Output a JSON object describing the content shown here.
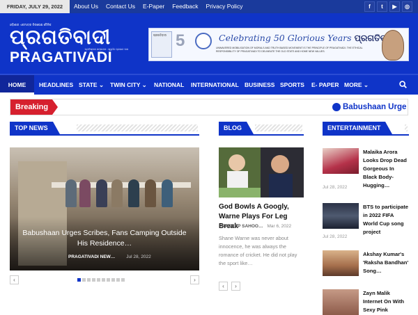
{
  "topbar": {
    "date": "FRIDAY, JULY 29, 2022",
    "links": [
      "About Us",
      "Contact Us",
      "E-Paper",
      "Feedback",
      "Privacy Policy"
    ],
    "social_icons": [
      "facebook-icon",
      "twitter-icon",
      "youtube-icon",
      "instagram-icon"
    ],
    "social_glyphs": [
      "f",
      "t",
      "▶",
      "◎"
    ]
  },
  "logo": {
    "tagline": "ଓଡ଼ିଶାର ଏକମାତ୍ର ନିରପେକ୍ଷ ଦୈନିକ",
    "odia_name": "ପ୍ରଗତିବାଦୀ",
    "founder": "ପ୍ରତିଷ୍ଠାତା ସମ୍ପାଦକ : ସ୍ୱର୍ଗତ ପ୍ରଭାତ ଦାସ",
    "english_name": "PRAGATIVADI"
  },
  "banner": {
    "mini_text": "ପ୍ରଗତିବାଦୀ",
    "fifty": "5",
    "celebrating": "Celebrating 50 Glorious Years",
    "brand": "ପ୍ରଗତିବାଦୀ",
    "small_text": "UNWAVERED MOBILISATION OF MORALS AND TRUTH BASED MOVEMENT IS THE PRINCIPLE OF PRAGATIVADI. THE ETHICAL RESPONSIBILITY OF PRAGATIVADI TO DELINEATE THE OLD STATE AND HOME NEW VALUES."
  },
  "nav": {
    "items": [
      {
        "label": "HOME",
        "caret": ""
      },
      {
        "label": "HEADLINES",
        "caret": ""
      },
      {
        "label": "STATE",
        "caret": "⌄"
      },
      {
        "label": "TWIN CITY",
        "caret": "⌄"
      },
      {
        "label": "NATIONAL",
        "caret": ""
      },
      {
        "label": "INTERNATIONAL",
        "caret": ""
      },
      {
        "label": "BUSINESS",
        "caret": ""
      },
      {
        "label": "SPORTS",
        "caret": ""
      },
      {
        "label": "E- PAPER",
        "caret": ""
      },
      {
        "label": "MORE",
        "caret": "⌄"
      }
    ]
  },
  "breaking": {
    "label": "Breaking",
    "headline": "Babushaan Urge"
  },
  "sections": {
    "top_news": "TOP NEWS",
    "blog": "BLOG",
    "entertainment": "ENTERTAINMENT"
  },
  "top_news": {
    "caption": "Babushaan Urges Scribes, Fans Camping Outside His Residence…",
    "author": "PRAGATIVADI NEW…",
    "date": "Jul 28, 2022",
    "prev": "‹",
    "next": "›",
    "dots_total": 10,
    "dots_active": 0
  },
  "blog": {
    "title": "God Bowls A Googly, Warne Plays For Leg Break",
    "author": "PRADEEP SAHOO…",
    "date": "Mar 6, 2022",
    "excerpt": "Shane Warne was never about innocence, he was always the romance of cricket. He did not play the sport like…",
    "prev": "‹",
    "next": "›"
  },
  "entertainment": [
    {
      "title": "Malaika Arora Looks Drop Dead Gorgeous In Black Body-Hugging…",
      "date": "Jul 28, 2022"
    },
    {
      "title": "BTS to participate in 2022 FIFA World Cup song project",
      "date": "Jul 28, 2022"
    },
    {
      "title": "Akshay Kumar's 'Raksha Bandhan' Song…",
      "date": ""
    },
    {
      "title": "Zayn Malik Internet On With Sexy Pink",
      "date": ""
    }
  ],
  "colors": {
    "brand_blue": "#0f34c8",
    "breaking_red": "#d6202e"
  }
}
